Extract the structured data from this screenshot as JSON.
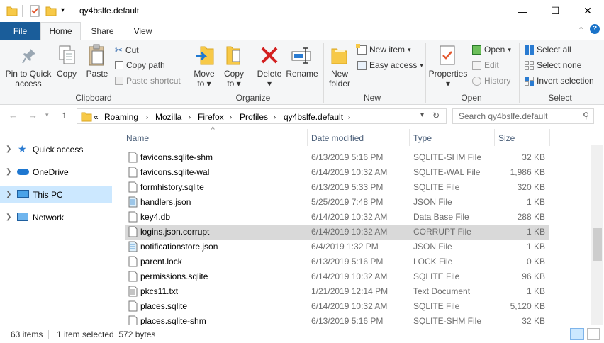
{
  "window": {
    "title": "qy4bslfe.default",
    "controls": [
      "minimize-icon",
      "maximize-icon",
      "close-icon"
    ]
  },
  "ribbon_tabs": {
    "file": "File",
    "home": "Home",
    "share": "Share",
    "view": "View"
  },
  "ribbon": {
    "clipboard": {
      "pin": "Pin to Quick access",
      "pin_l1": "Pin to Quick",
      "pin_l2": "access",
      "copy": "Copy",
      "paste": "Paste",
      "cut": "Cut",
      "copy_path": "Copy path",
      "paste_shortcut": "Paste shortcut",
      "label": "Clipboard"
    },
    "organize": {
      "move_l1": "Move",
      "move_l2": "to",
      "copy_l1": "Copy",
      "copy_l2": "to",
      "delete": "Delete",
      "rename": "Rename",
      "label": "Organize"
    },
    "new": {
      "folder_l1": "New",
      "folder_l2": "folder",
      "new_item": "New item",
      "easy_access": "Easy access",
      "label": "New"
    },
    "open": {
      "properties": "Properties",
      "open": "Open",
      "edit": "Edit",
      "history": "History",
      "label": "Open"
    },
    "select": {
      "select_all": "Select all",
      "select_none": "Select none",
      "invert": "Invert selection",
      "label": "Select"
    }
  },
  "address": {
    "overflow": "«",
    "crumbs": [
      "Roaming",
      "Mozilla",
      "Firefox",
      "Profiles",
      "qy4bslfe.default"
    ],
    "search_placeholder": "Search qy4bslfe.default"
  },
  "nav_pane": [
    {
      "label": "Quick access",
      "icon": "star-icon"
    },
    {
      "label": "OneDrive",
      "icon": "cloud-icon"
    },
    {
      "label": "This PC",
      "icon": "computer-icon",
      "selected": true
    },
    {
      "label": "Network",
      "icon": "network-icon"
    }
  ],
  "columns": {
    "name": "Name",
    "date": "Date modified",
    "type": "Type",
    "size": "Size"
  },
  "files": [
    {
      "name": "favicons.sqlite-shm",
      "date": "6/13/2019 5:16 PM",
      "type": "SQLITE-SHM File",
      "size": "32 KB",
      "icon": "file-icon"
    },
    {
      "name": "favicons.sqlite-wal",
      "date": "6/14/2019 10:32 AM",
      "type": "SQLITE-WAL File",
      "size": "1,986 KB",
      "icon": "file-icon"
    },
    {
      "name": "formhistory.sqlite",
      "date": "6/13/2019 5:33 PM",
      "type": "SQLITE File",
      "size": "320 KB",
      "icon": "file-icon"
    },
    {
      "name": "handlers.json",
      "date": "5/25/2019 7:48 PM",
      "type": "JSON File",
      "size": "1 KB",
      "icon": "json-file-icon"
    },
    {
      "name": "key4.db",
      "date": "6/14/2019 10:32 AM",
      "type": "Data Base File",
      "size": "288 KB",
      "icon": "file-icon"
    },
    {
      "name": "logins.json.corrupt",
      "date": "6/14/2019 10:32 AM",
      "type": "CORRUPT File",
      "size": "1 KB",
      "icon": "file-icon",
      "selected": true
    },
    {
      "name": "notificationstore.json",
      "date": "6/4/2019 1:32 PM",
      "type": "JSON File",
      "size": "1 KB",
      "icon": "json-file-icon"
    },
    {
      "name": "parent.lock",
      "date": "6/13/2019 5:16 PM",
      "type": "LOCK File",
      "size": "0 KB",
      "icon": "file-icon"
    },
    {
      "name": "permissions.sqlite",
      "date": "6/14/2019 10:32 AM",
      "type": "SQLITE File",
      "size": "96 KB",
      "icon": "file-icon"
    },
    {
      "name": "pkcs11.txt",
      "date": "1/21/2019 12:14 PM",
      "type": "Text Document",
      "size": "1 KB",
      "icon": "text-file-icon"
    },
    {
      "name": "places.sqlite",
      "date": "6/14/2019 10:32 AM",
      "type": "SQLITE File",
      "size": "5,120 KB",
      "icon": "file-icon"
    },
    {
      "name": "places.sqlite-shm",
      "date": "6/13/2019 5:16 PM",
      "type": "SQLITE-SHM File",
      "size": "32 KB",
      "icon": "file-icon"
    }
  ],
  "status": {
    "count": "63 items",
    "selection": "1 item selected  572 bytes"
  },
  "colors": {
    "accent": "#1a5d9a",
    "selection": "#d9d9d9",
    "nav_selected": "#cce8ff"
  }
}
